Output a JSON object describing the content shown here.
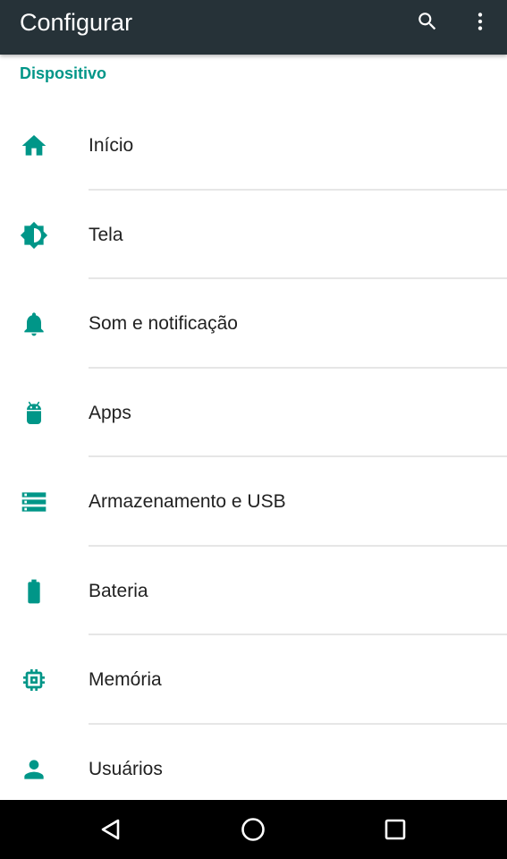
{
  "app": {
    "title": "Configurar"
  },
  "toolbar": {
    "actions": [
      {
        "name": "search",
        "icon": "search-icon"
      },
      {
        "name": "more-options",
        "icon": "more-vert-icon"
      }
    ]
  },
  "section": {
    "header": "Dispositivo"
  },
  "items": [
    {
      "label": "Início",
      "icon": "home-icon"
    },
    {
      "label": "Tela",
      "icon": "brightness-icon"
    },
    {
      "label": "Som e notificação",
      "icon": "bell-icon"
    },
    {
      "label": "Apps",
      "icon": "android-icon"
    },
    {
      "label": "Armazenamento e USB",
      "icon": "storage-icon"
    },
    {
      "label": "Bateria",
      "icon": "battery-icon"
    },
    {
      "label": "Memória",
      "icon": "memory-icon"
    },
    {
      "label": "Usuários",
      "icon": "person-icon"
    }
  ],
  "navbar": {
    "buttons": [
      {
        "name": "back",
        "icon": "back-triangle-icon"
      },
      {
        "name": "home",
        "icon": "home-circle-icon"
      },
      {
        "name": "recents",
        "icon": "recents-square-icon"
      }
    ]
  },
  "colors": {
    "toolbar_bg": "#263238",
    "accent": "#009688",
    "text_primary": "#212121",
    "divider": "#e6e6e6",
    "navbar_bg": "#000000"
  }
}
